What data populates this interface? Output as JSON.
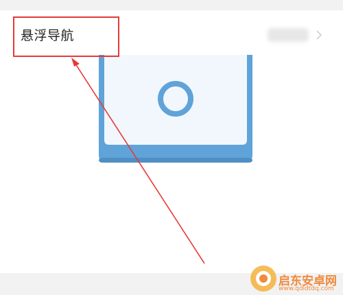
{
  "setting_row": {
    "title": "悬浮导航",
    "value": ""
  },
  "illustration": {
    "frame_color": "#5fa3d9",
    "screen_color": "#f1f7fd",
    "ring_color": "#5fa3d9"
  },
  "annotation": {
    "color": "#e53935"
  },
  "watermark": {
    "name": "启东安卓网",
    "url": "www.qdldtdq.com",
    "color": "#f08a3c"
  },
  "icons": {
    "chevron": "chevron-right-icon",
    "float_ball": "floating-ball-icon",
    "watermark_logo": "watermark-logo-icon"
  }
}
